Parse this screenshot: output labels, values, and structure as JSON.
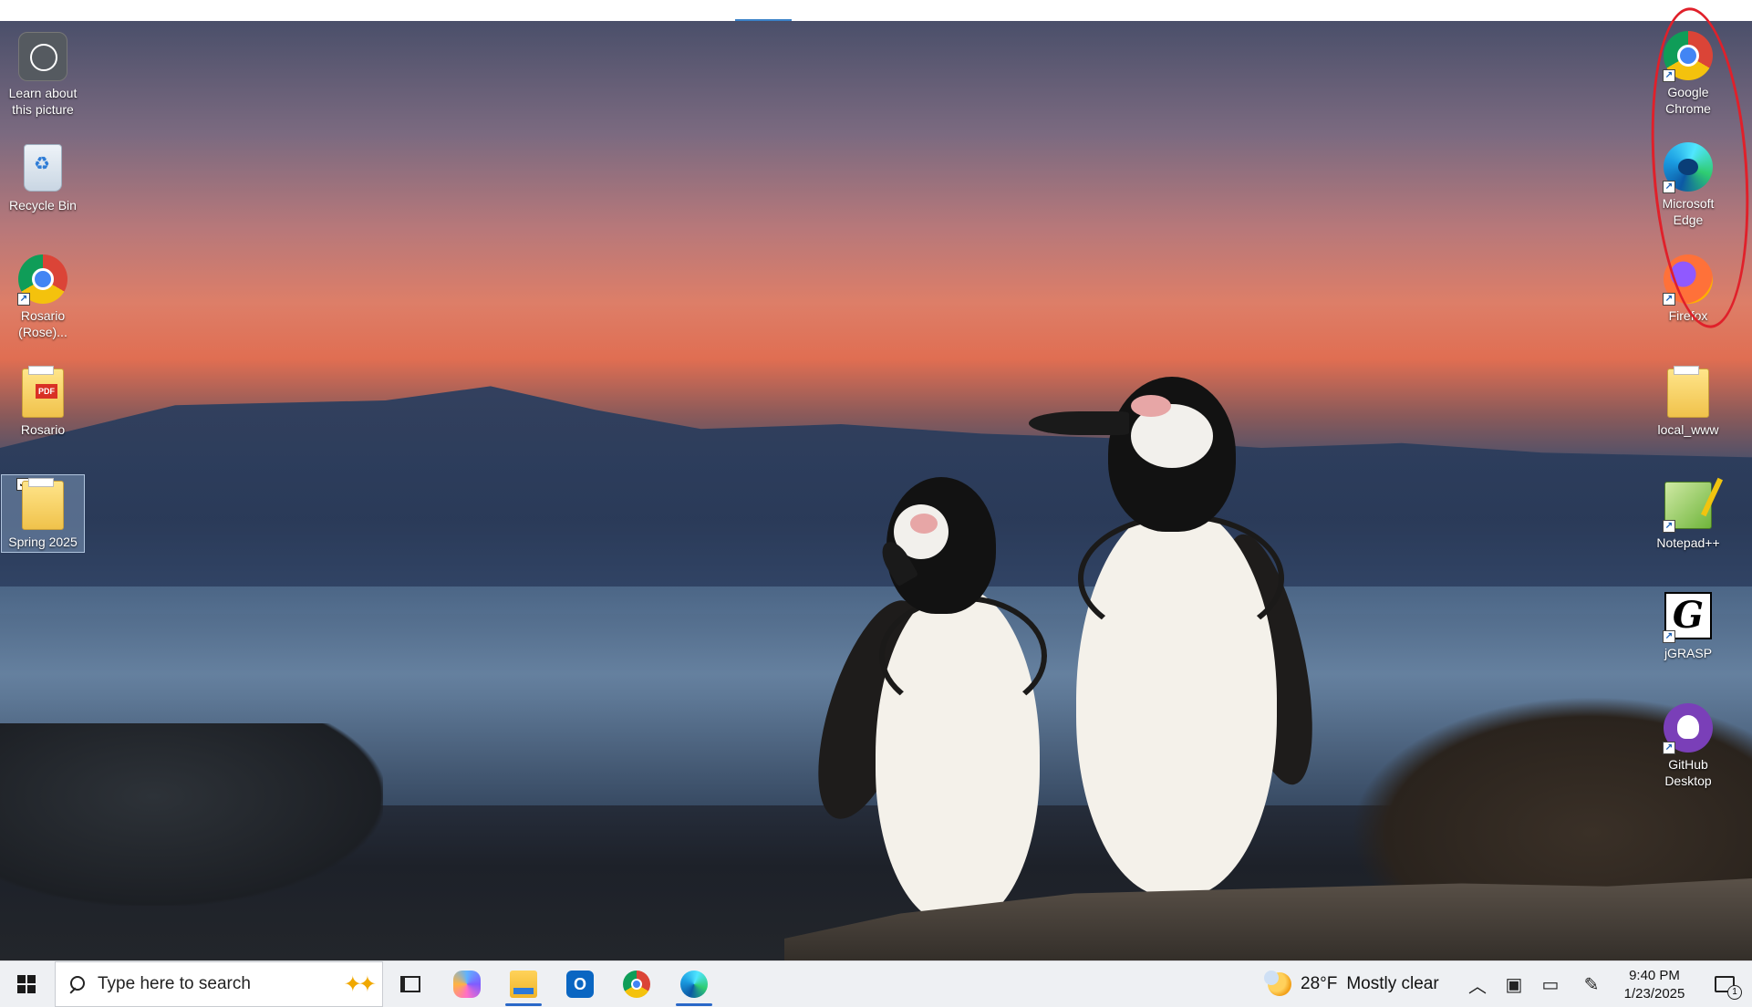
{
  "desktop": {
    "left_icons": [
      {
        "label": "Learn about this picture",
        "icon": "learn-about-picture-icon"
      },
      {
        "label": "Recycle Bin",
        "icon": "recycle-bin-icon"
      },
      {
        "label": "Rosario (Rose)...",
        "icon": "chrome-profile-icon"
      },
      {
        "label": "Rosario",
        "icon": "pdf-folder-icon"
      },
      {
        "label": "Spring 2025",
        "icon": "folder-icon"
      }
    ],
    "right_icons": [
      {
        "label": "Google Chrome",
        "icon": "chrome-icon"
      },
      {
        "label": "Microsoft Edge",
        "icon": "edge-icon"
      },
      {
        "label": "Firefox",
        "icon": "firefox-icon"
      },
      {
        "label": "local_www",
        "icon": "folder-icon"
      },
      {
        "label": "Notepad++",
        "icon": "notepad-plus-plus-icon"
      },
      {
        "label": "jGRASP",
        "icon": "jgrasp-icon"
      },
      {
        "label": "GitHub Desktop",
        "icon": "github-desktop-icon"
      }
    ],
    "pdf_badge": "PDF",
    "jgrasp_letter": "G",
    "annotation_color": "#e0202a"
  },
  "taskbar": {
    "search_placeholder": "Type here to search",
    "pinned_apps": [
      "copilot",
      "file-explorer",
      "outlook",
      "google-chrome",
      "microsoft-edge"
    ],
    "outlook_letter": "O",
    "weather": {
      "temperature": "28°F",
      "condition": "Mostly clear"
    },
    "clock": {
      "time": "9:40 PM",
      "date": "1/23/2025"
    },
    "notification_count": "1",
    "accent_color": "#2a68c8"
  }
}
